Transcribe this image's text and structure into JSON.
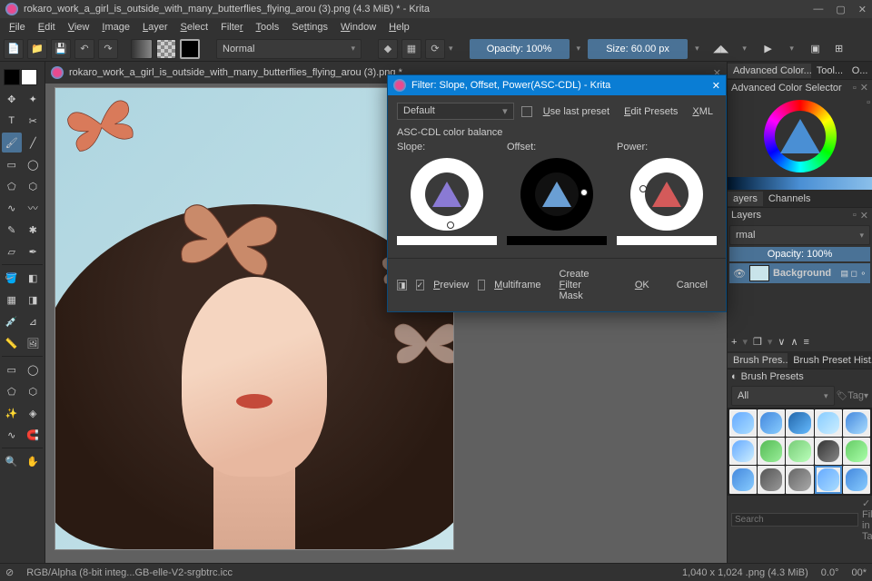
{
  "window": {
    "title": "rokaro_work_a_girl_is_outside_with_many_butterflies_flying_arou (3).png (4.3 MiB) * - Krita",
    "minimize": "—",
    "maximize": "▢",
    "close": "✕"
  },
  "menu": [
    "File",
    "Edit",
    "View",
    "Image",
    "Layer",
    "Select",
    "Filter",
    "Tools",
    "Settings",
    "Window",
    "Help"
  ],
  "toolbar": {
    "blend_mode": "Normal",
    "opacity": "Opacity: 100%",
    "size": "Size: 60.00 px"
  },
  "doc_tab": {
    "name": "rokaro_work_a_girl_is_outside_with_many_butterflies_flying_arou (3).png *",
    "close": "✕"
  },
  "rightpanel": {
    "tabs_top": [
      "Advanced Color...",
      "Tool...",
      "O..."
    ],
    "selector_label": "Advanced Color Selector",
    "layer_tabs": [
      "ayers",
      "Channels"
    ],
    "layers_label": "Layers",
    "blend": "rmal",
    "layer_opacity": "Opacity:  100%",
    "layer_name": "Background",
    "brush_tabs": [
      "Brush Pres...",
      "Brush Preset Hist..."
    ],
    "brush_presets": "Brush Presets",
    "brush_filter": "All",
    "brush_tag": "Tag",
    "search_ph": "Search",
    "filter_tag": "Filter in Tag"
  },
  "dialog": {
    "title": "Filter: Slope, Offset, Power(ASC-CDL) - Krita",
    "close": "✕",
    "dropdown": "Default",
    "use_last": "Use last preset",
    "edit_presets": "Edit Presets",
    "xml": "XML",
    "section": "ASC-CDL  color balance",
    "slope": "Slope:",
    "offset": "Offset:",
    "power": "Power:",
    "preview": "Preview",
    "multiframe": "Multiframe",
    "create_mask": "Create Filter Mask",
    "ok": "OK",
    "cancel": "Cancel"
  },
  "status": {
    "profile": "RGB/Alpha (8-bit integ...GB-elle-V2-srgbtrc.icc",
    "dims": "1,040 x 1,024 .png (4.3 MiB)",
    "zoom": "0.0°",
    "extra": "00*"
  }
}
